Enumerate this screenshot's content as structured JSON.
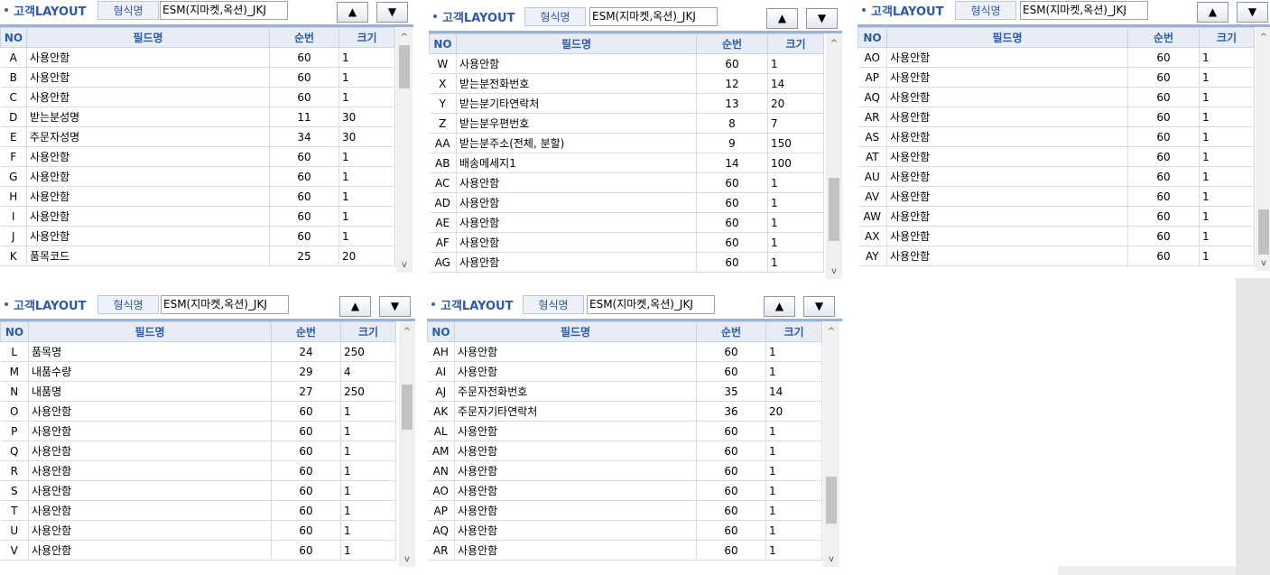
{
  "ui": {
    "title": "고객LAYOUT",
    "format_label": "형식명",
    "format_value": "ESM(지마켓,옥션)_JKJ",
    "up": "▲",
    "down": "▼",
    "scroll_up": "^",
    "scroll_down": "v"
  },
  "columns": {
    "no": "NO",
    "name": "필드명",
    "seq": "순번",
    "size": "크기"
  },
  "panels": [
    {
      "rows": [
        {
          "no": "A",
          "name": "사용안함",
          "seq": "60",
          "size": "1"
        },
        {
          "no": "B",
          "name": "사용안함",
          "seq": "60",
          "size": "1"
        },
        {
          "no": "C",
          "name": "사용안함",
          "seq": "60",
          "size": "1"
        },
        {
          "no": "D",
          "name": "받는분성명",
          "seq": "11",
          "size": "30"
        },
        {
          "no": "E",
          "name": "주문자성명",
          "seq": "34",
          "size": "30"
        },
        {
          "no": "F",
          "name": "사용안함",
          "seq": "60",
          "size": "1"
        },
        {
          "no": "G",
          "name": "사용안함",
          "seq": "60",
          "size": "1"
        },
        {
          "no": "H",
          "name": "사용안함",
          "seq": "60",
          "size": "1"
        },
        {
          "no": "I",
          "name": "사용안함",
          "seq": "60",
          "size": "1"
        },
        {
          "no": "J",
          "name": "사용안함",
          "seq": "60",
          "size": "1"
        },
        {
          "no": "K",
          "name": "품목코드",
          "seq": "25",
          "size": "20"
        }
      ]
    },
    {
      "rows": [
        {
          "no": "W",
          "name": "사용안함",
          "seq": "60",
          "size": "1"
        },
        {
          "no": "X",
          "name": "받는분전화번호",
          "seq": "12",
          "size": "14"
        },
        {
          "no": "Y",
          "name": "받는분기타연락처",
          "seq": "13",
          "size": "20"
        },
        {
          "no": "Z",
          "name": "받는분우편번호",
          "seq": "8",
          "size": "7"
        },
        {
          "no": "AA",
          "name": "받는분주소(전체, 분할)",
          "seq": "9",
          "size": "150"
        },
        {
          "no": "AB",
          "name": "배송메세지1",
          "seq": "14",
          "size": "100"
        },
        {
          "no": "AC",
          "name": "사용안함",
          "seq": "60",
          "size": "1"
        },
        {
          "no": "AD",
          "name": "사용안함",
          "seq": "60",
          "size": "1"
        },
        {
          "no": "AE",
          "name": "사용안함",
          "seq": "60",
          "size": "1"
        },
        {
          "no": "AF",
          "name": "사용안함",
          "seq": "60",
          "size": "1"
        },
        {
          "no": "AG",
          "name": "사용안함",
          "seq": "60",
          "size": "1"
        }
      ]
    },
    {
      "rows": [
        {
          "no": "AO",
          "name": "사용안함",
          "seq": "60",
          "size": "1"
        },
        {
          "no": "AP",
          "name": "사용안함",
          "seq": "60",
          "size": "1"
        },
        {
          "no": "AQ",
          "name": "사용안함",
          "seq": "60",
          "size": "1"
        },
        {
          "no": "AR",
          "name": "사용안함",
          "seq": "60",
          "size": "1"
        },
        {
          "no": "AS",
          "name": "사용안함",
          "seq": "60",
          "size": "1"
        },
        {
          "no": "AT",
          "name": "사용안함",
          "seq": "60",
          "size": "1"
        },
        {
          "no": "AU",
          "name": "사용안함",
          "seq": "60",
          "size": "1"
        },
        {
          "no": "AV",
          "name": "사용안함",
          "seq": "60",
          "size": "1"
        },
        {
          "no": "AW",
          "name": "사용안함",
          "seq": "60",
          "size": "1"
        },
        {
          "no": "AX",
          "name": "사용안함",
          "seq": "60",
          "size": "1"
        },
        {
          "no": "AY",
          "name": "사용안함",
          "seq": "60",
          "size": "1"
        }
      ]
    },
    {
      "rows": [
        {
          "no": "L",
          "name": "품목명",
          "seq": "24",
          "size": "250"
        },
        {
          "no": "M",
          "name": "내품수량",
          "seq": "29",
          "size": "4"
        },
        {
          "no": "N",
          "name": "내품명",
          "seq": "27",
          "size": "250"
        },
        {
          "no": "O",
          "name": "사용안함",
          "seq": "60",
          "size": "1"
        },
        {
          "no": "P",
          "name": "사용안함",
          "seq": "60",
          "size": "1"
        },
        {
          "no": "Q",
          "name": "사용안함",
          "seq": "60",
          "size": "1"
        },
        {
          "no": "R",
          "name": "사용안함",
          "seq": "60",
          "size": "1"
        },
        {
          "no": "S",
          "name": "사용안함",
          "seq": "60",
          "size": "1"
        },
        {
          "no": "T",
          "name": "사용안함",
          "seq": "60",
          "size": "1"
        },
        {
          "no": "U",
          "name": "사용안함",
          "seq": "60",
          "size": "1"
        },
        {
          "no": "V",
          "name": "사용안함",
          "seq": "60",
          "size": "1"
        }
      ]
    },
    {
      "rows": [
        {
          "no": "AH",
          "name": "사용안함",
          "seq": "60",
          "size": "1"
        },
        {
          "no": "AI",
          "name": "사용안함",
          "seq": "60",
          "size": "1"
        },
        {
          "no": "AJ",
          "name": "주문자전화번호",
          "seq": "35",
          "size": "14"
        },
        {
          "no": "AK",
          "name": "주문자기타연락처",
          "seq": "36",
          "size": "20"
        },
        {
          "no": "AL",
          "name": "사용안함",
          "seq": "60",
          "size": "1"
        },
        {
          "no": "AM",
          "name": "사용안함",
          "seq": "60",
          "size": "1"
        },
        {
          "no": "AN",
          "name": "사용안함",
          "seq": "60",
          "size": "1"
        },
        {
          "no": "AO",
          "name": "사용안함",
          "seq": "60",
          "size": "1"
        },
        {
          "no": "AP",
          "name": "사용안함",
          "seq": "60",
          "size": "1"
        },
        {
          "no": "AQ",
          "name": "사용안함",
          "seq": "60",
          "size": "1"
        },
        {
          "no": "AR",
          "name": "사용안함",
          "seq": "60",
          "size": "1"
        }
      ]
    }
  ]
}
